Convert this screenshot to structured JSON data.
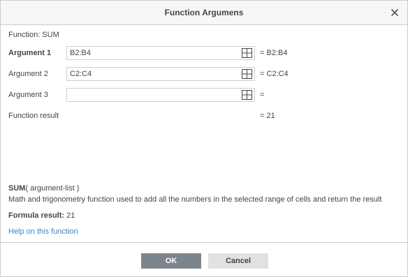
{
  "dialog": {
    "title": "Function Argumens"
  },
  "function_line": "Function: SUM",
  "arguments": [
    {
      "label": "Argument 1",
      "value": "B2:B4",
      "result": "= B2:B4"
    },
    {
      "label": "Argument 2",
      "value": "C2:C4",
      "result": "= C2:C4"
    },
    {
      "label": "Argument 3",
      "value": "",
      "result": "="
    }
  ],
  "function_result": {
    "label": "Function result",
    "value": "= 21"
  },
  "description": {
    "name": "SUM",
    "signature": "( argument-list )",
    "text": "Math and trigonometry function used to add all the numbers in the selected range of cells and return the result"
  },
  "formula_result": {
    "label": "Formula result:",
    "value": "21"
  },
  "help_link": "Help on this function",
  "buttons": {
    "ok": "OK",
    "cancel": "Cancel"
  },
  "icons": {
    "close": "close-icon",
    "range": "range-select-icon"
  },
  "colors": {
    "ok_button": "#7d858c",
    "cancel_button": "#e1e1e1",
    "link": "#3a87c8"
  }
}
